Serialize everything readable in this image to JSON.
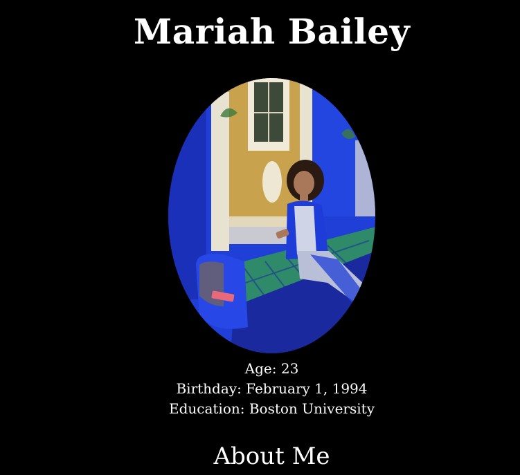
{
  "profile": {
    "name": "Mariah Bailey",
    "age_line": "Age: 23",
    "birthday_line": "Birthday: February 1, 1994",
    "education_line": "Education: Boston University"
  },
  "sections": {
    "about_heading": "About Me"
  },
  "photo": {
    "subject": "woman-seated-on-blue-tiled-bench",
    "palette": {
      "wall_blue": "#1f3fd6",
      "deep_blue": "#1a2a9e",
      "ochre": "#c9a24d",
      "tile_green": "#2f8a6a",
      "plaster": "#e8e2d0"
    }
  }
}
